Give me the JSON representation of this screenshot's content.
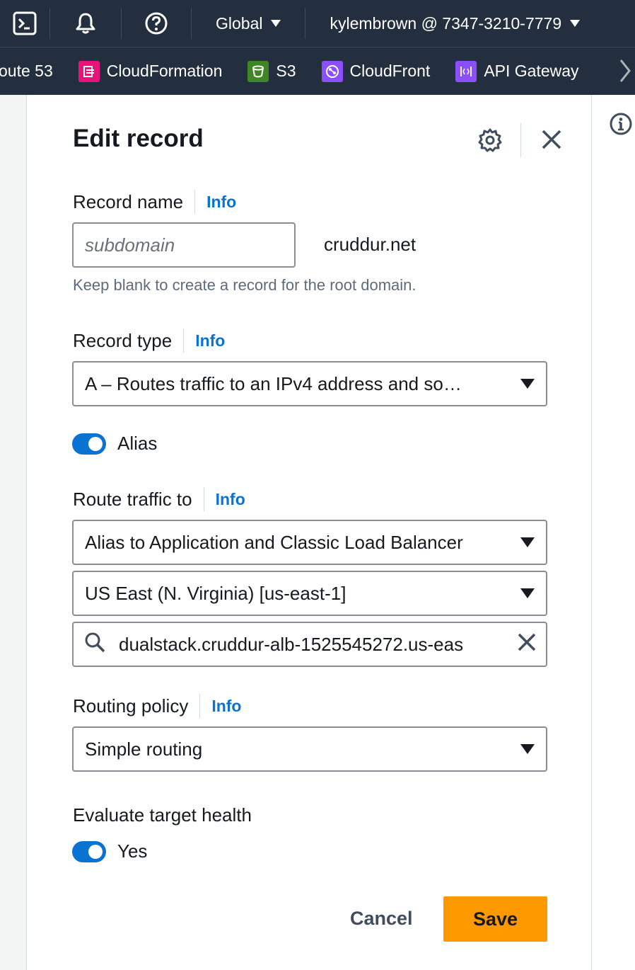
{
  "topbar": {
    "region": "Global",
    "account": "kylembrown @ 7347-3210-7779"
  },
  "favorites": [
    {
      "label": "oute 53",
      "icon": "route53-icon",
      "color": ""
    },
    {
      "label": "CloudFormation",
      "icon": "cloudformation-icon",
      "color": "#e7157b"
    },
    {
      "label": "S3",
      "icon": "s3-icon",
      "color": "#3f8624"
    },
    {
      "label": "CloudFront",
      "icon": "cloudfront-icon",
      "color": "#8c4fff"
    },
    {
      "label": "API Gateway",
      "icon": "api-gateway-icon",
      "color": "#8c4fff"
    }
  ],
  "panel": {
    "title": "Edit record",
    "record_name": {
      "label": "Record name",
      "info": "Info",
      "placeholder": "subdomain",
      "value": "",
      "domain_suffix": "cruddur.net",
      "hint": "Keep blank to create a record for the root domain."
    },
    "record_type": {
      "label": "Record type",
      "info": "Info",
      "value": "A – Routes traffic to an IPv4 address and so…"
    },
    "alias": {
      "label": "Alias",
      "enabled": true
    },
    "route_traffic": {
      "label": "Route traffic to",
      "info": "Info",
      "endpoint": "Alias to Application and Classic Load Balancer",
      "region": "US East (N. Virginia) [us-east-1]",
      "target": "dualstack.cruddur-alb-1525545272.us-eas"
    },
    "routing_policy": {
      "label": "Routing policy",
      "info": "Info",
      "value": "Simple routing"
    },
    "evaluate_health": {
      "label": "Evaluate target health",
      "toggle_label": "Yes",
      "enabled": true
    },
    "actions": {
      "cancel": "Cancel",
      "save": "Save"
    }
  },
  "colors": {
    "nav_bg": "#232f3e",
    "link": "#0972d3",
    "primary_button": "#ff9900",
    "toggle_on": "#0972d3"
  }
}
